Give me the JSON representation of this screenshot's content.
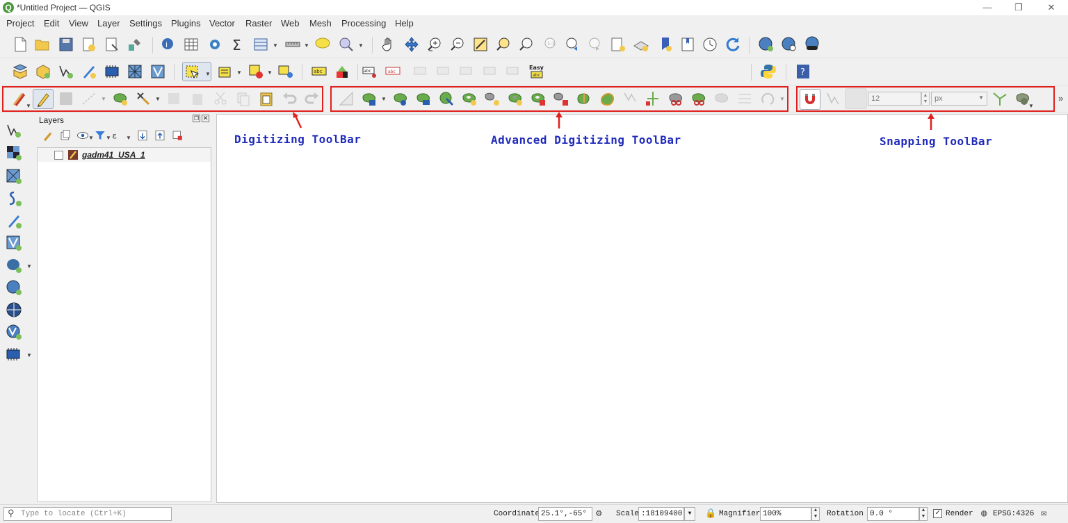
{
  "window": {
    "title": "*Untitled Project — QGIS",
    "app_icon": "Q"
  },
  "menu": [
    "Project",
    "Edit",
    "View",
    "Layer",
    "Settings",
    "Plugins",
    "Vector",
    "Raster",
    "Web",
    "Mesh",
    "Processing",
    "Help"
  ],
  "annotations": {
    "digitizing": "Digitizing ToolBar",
    "advanced": "Advanced Digitizing ToolBar",
    "snapping": "Snapping ToolBar"
  },
  "snapping": {
    "tolerance": "12",
    "unit": "px"
  },
  "easy_label": "Easy",
  "abc_label": "abc",
  "layers_panel": {
    "title": "Layers",
    "layer_name": "gadm41_USA_1"
  },
  "statusbar": {
    "locator_placeholder": "Type to locate (Ctrl+K)",
    "coordinate_label": "Coordinate",
    "coordinate_value": "25.1°,-65°",
    "scale_label": "Scale",
    "scale_value": ":18109400",
    "magnifier_label": "Magnifier",
    "magnifier_value": "100%",
    "rotation_label": "Rotation",
    "rotation_value": "0.0 °",
    "render_label": "Render",
    "crs": "EPSG:4326"
  },
  "colors": {
    "annotation_red": "#e0201c",
    "annotation_blue": "#1f2aba",
    "qgis_green": "#4b9a3a"
  }
}
